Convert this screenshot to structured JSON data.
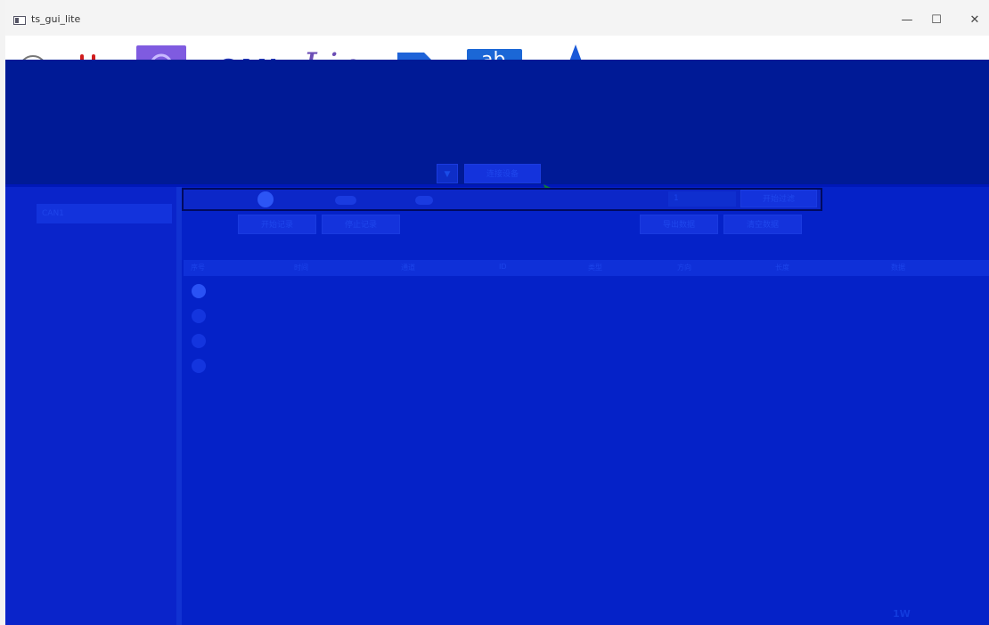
{
  "window": {
    "title": "ts_gui_lite",
    "controls": {
      "minimize": "—",
      "maximize": "☐",
      "close": "✕"
    }
  },
  "toolbar": {
    "can_label": "CAN",
    "lin_label": "Lin",
    "ab_label": "ab"
  },
  "colors": {
    "overlay": "#0018b9",
    "accent": "#2c55f5",
    "stop_red": "#d11c1c"
  },
  "top_controls": {
    "dropdown_symbol": "▼",
    "connect_label": "连接设备"
  },
  "sidebar": {
    "items": [
      {
        "label": "CAN1"
      }
    ]
  },
  "filter_bar": {
    "count_value": "1",
    "apply_label": "开始过滤"
  },
  "actions": {
    "start_record": "开始记录",
    "stop_record": "停止记录",
    "export": "导出数据",
    "clear": "清空数据"
  },
  "table": {
    "headers": [
      "序号",
      "时间",
      "通道",
      "ID",
      "类型",
      "方向",
      "长度",
      "数据"
    ]
  },
  "status": {
    "text": "1W"
  }
}
